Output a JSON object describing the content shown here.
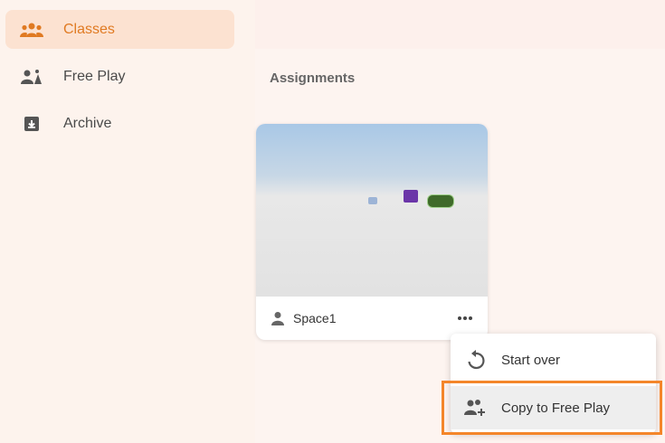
{
  "sidebar": {
    "items": [
      {
        "label": "Classes",
        "icon": "group-icon",
        "active": true
      },
      {
        "label": "Free Play",
        "icon": "person-shapes-icon",
        "active": false
      },
      {
        "label": "Archive",
        "icon": "archive-icon",
        "active": false
      }
    ]
  },
  "main": {
    "section_title": "Assignments",
    "card": {
      "name": "Space1"
    }
  },
  "context_menu": {
    "items": [
      {
        "label": "Start over",
        "icon": "restart-icon"
      },
      {
        "label": "Copy to Free Play",
        "icon": "add-person-icon"
      }
    ]
  },
  "colors": {
    "accent": "#e07a22",
    "active_bg": "#fce2d1",
    "highlight_border": "#f4862a"
  }
}
